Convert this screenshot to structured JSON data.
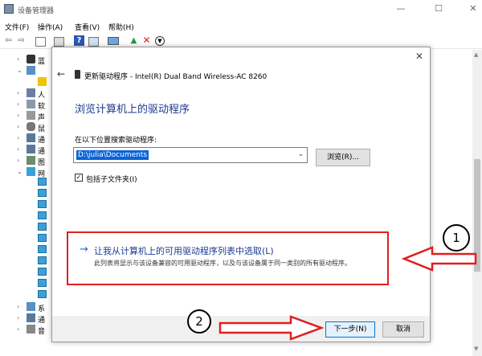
{
  "window": {
    "title": "设备管理器"
  },
  "menu": [
    "文件(F)",
    "操作(A)",
    "查看(V)",
    "帮助(H)"
  ],
  "window_buttons": {
    "minimize": "—",
    "maximize": "☐",
    "close": "✕"
  },
  "tree": [
    "蓝",
    "",
    "人",
    "软",
    "声",
    "鼠",
    "通",
    "通",
    "图",
    "网",
    "",
    "",
    "",
    "",
    "",
    "",
    "",
    "",
    "",
    "",
    "",
    "",
    "系",
    "通",
    "音"
  ],
  "dialog": {
    "window_title": "更新驱动程序 - Intel(R) Dual Band Wireless-AC 8260",
    "close": "✕",
    "back": "←",
    "heading": "浏览计算机上的驱动程序",
    "search_label": "在以下位置搜索驱动程序:",
    "path_value": "D:\\julia\\Documents",
    "browse_label": "浏览(R)...",
    "subfolder_checked": true,
    "subfolder_mark": "✓",
    "subfolder_label": "包括子文件夹(I)",
    "option_arrow": "→",
    "option_title": "让我从计算机上的可用驱动程序列表中选取(L)",
    "option_desc": "此列表将显示与该设备兼容的可用驱动程序，以及与该设备属于同一类别的所有驱动程序。",
    "next_label": "下一步(N)",
    "cancel_label": "取消"
  },
  "annotations": {
    "circle_1": "1",
    "circle_2": "2",
    "accent_red": "#e02020",
    "arrow_fill": "#ffffff"
  }
}
